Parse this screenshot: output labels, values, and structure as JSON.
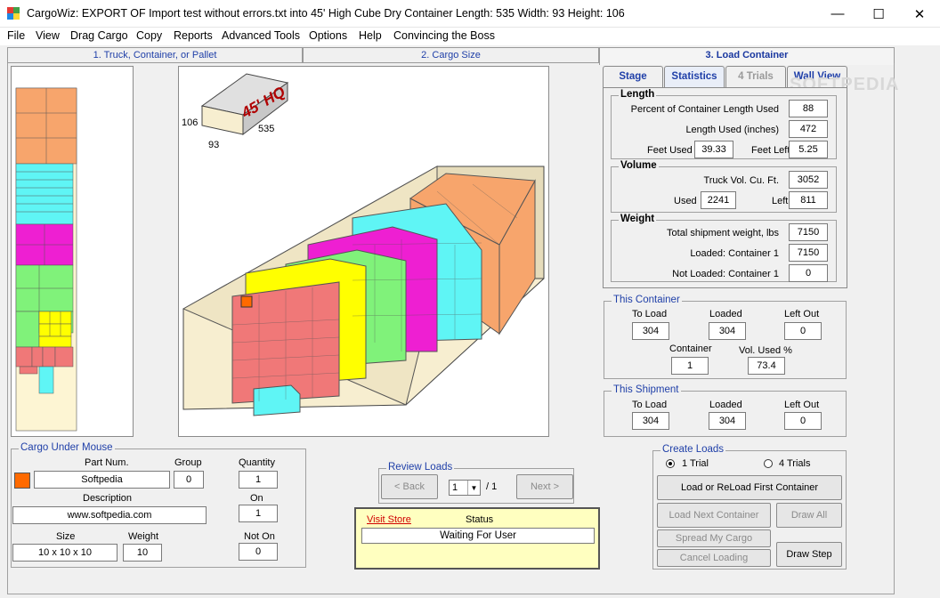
{
  "window": {
    "title": "CargoWiz:  EXPORT OF Import test without errors.txt into  45' High Cube Dry Container  Length: 535  Width: 93  Height: 106"
  },
  "menu": [
    "File",
    "View",
    "Drag Cargo",
    "Copy",
    "Reports",
    "Advanced Tools",
    "Options",
    "Help",
    "Convincing the Boss"
  ],
  "tabs": [
    "1. Truck, Container, or Pallet",
    "2. Cargo Size",
    "3. Load Container"
  ],
  "subtabs": [
    "Stage",
    "Statistics",
    "4 Trials",
    "Wall View"
  ],
  "container_icon": {
    "label": "45' HQ",
    "length": "535",
    "width": "93",
    "height": "106"
  },
  "stats": {
    "length": {
      "title": "Length",
      "pct_label": "Percent of Container Length Used",
      "pct": "88",
      "used_label": "Length Used (inches)",
      "used": "472",
      "feet_used_label": "Feet Used",
      "feet_used": "39.33",
      "feet_left_label": "Feet Left",
      "feet_left": "5.25"
    },
    "volume": {
      "title": "Volume",
      "truck_label": "Truck Vol. Cu. Ft.",
      "truck": "3052",
      "used_label": "Used",
      "used": "2241",
      "left_label": "Left",
      "left": "811"
    },
    "weight": {
      "title": "Weight",
      "total_label": "Total shipment weight, lbs",
      "total": "7150",
      "loaded_label": "Loaded: Container 1",
      "loaded": "7150",
      "notloaded_label": "Not Loaded: Container 1",
      "notloaded": "0"
    }
  },
  "this_container": {
    "title": "This Container",
    "to_load_label": "To Load",
    "to_load": "304",
    "loaded_label": "Loaded",
    "loaded": "304",
    "left_out_label": "Left Out",
    "left_out": "0",
    "container_label": "Container",
    "container": "1",
    "vol_used_label": "Vol. Used %",
    "vol_used": "73.4"
  },
  "this_shipment": {
    "title": "This Shipment",
    "to_load_label": "To Load",
    "to_load": "304",
    "loaded_label": "Loaded",
    "loaded": "304",
    "left_out_label": "Left Out",
    "left_out": "0"
  },
  "create_loads": {
    "title": "Create Loads",
    "radio1": "1 Trial",
    "radio2": "4 Trials",
    "load_first": "Load or ReLoad First Container",
    "load_next": "Load Next Container",
    "draw_all": "Draw All",
    "spread": "Spread My Cargo",
    "cancel": "Cancel Loading",
    "draw_step": "Draw Step"
  },
  "cargo_under_mouse": {
    "title": "Cargo Under Mouse",
    "part_label": "Part Num.",
    "part": "Softpedia",
    "group_label": "Group",
    "group": "0",
    "quantity_label": "Quantity",
    "quantity": "1",
    "desc_label": "Description",
    "desc": "www.softpedia.com",
    "on_label": "On",
    "on": "1",
    "size_label": "Size",
    "size": "10 x 10 x 10",
    "weight_label": "Weight",
    "weight": "10",
    "noton_label": "Not On",
    "noton": "0",
    "swatch_color": "#ff6a00"
  },
  "review_loads": {
    "title": "Review Loads",
    "back": "< Back",
    "next": "Next >",
    "page": "1",
    "of": "/ 1"
  },
  "status": {
    "visit": "Visit Store",
    "label": "Status",
    "text": "Waiting For User"
  },
  "watermark": "SOFTPEDIA"
}
